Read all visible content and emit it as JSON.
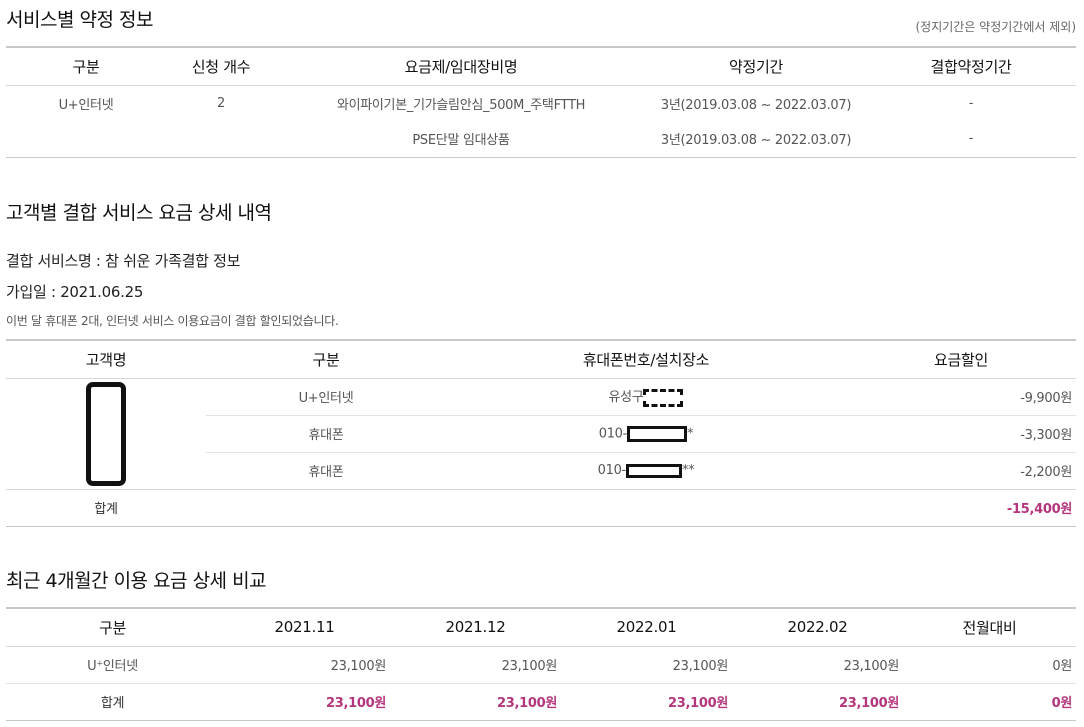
{
  "section1": {
    "title": "서비스별 약정 정보",
    "note": "(정지기간은 약정기간에서 제외)",
    "headers": [
      "구분",
      "신청 개수",
      "요금제/임대장비명",
      "약정기간",
      "결합약정기간"
    ],
    "rows": [
      {
        "category": "U+인터넷",
        "count": "2",
        "plan": "와이파이기본_기가슬림안심_500M_주택FTTH",
        "period": "3년(2019.03.08 ~ 2022.03.07)",
        "combined": "-"
      },
      {
        "category": "",
        "count": "",
        "plan": "PSE단말 임대상품",
        "period": "3년(2019.03.08 ~ 2022.03.07)",
        "combined": "-"
      }
    ]
  },
  "section2": {
    "title": "고객별 결합 서비스 요금 상세 내역",
    "service_name": "결합 서비스명 : 참 쉬운 가족결합 정보",
    "join_date": "가입일 : 2021.06.25",
    "description": "이번 달 휴대폰 2대, 인터넷 서비스 이용요금이 결합 할인되었습니다.",
    "headers": [
      "고객명",
      "구분",
      "휴대폰번호/설치장소",
      "요금할인"
    ],
    "rows": [
      {
        "category": "U+인터넷",
        "location_prefix": "유성구",
        "location_suffix": "",
        "discount": "-9,900원"
      },
      {
        "category": "휴대폰",
        "location_prefix": "010-",
        "location_suffix": "*",
        "discount": "-3,300원"
      },
      {
        "category": "휴대폰",
        "location_prefix": "010-",
        "location_suffix": "**",
        "discount": "-2,200원"
      }
    ],
    "total_label": "합계",
    "total_discount": "-15,400원"
  },
  "section3": {
    "title": "최근 4개월간 이용 요금 상세 비교",
    "headers": [
      "구분",
      "2021.11",
      "2021.12",
      "2022.01",
      "2022.02",
      "전월대비"
    ],
    "row": {
      "category": "U⁺인터넷",
      "values": [
        "23,100원",
        "23,100원",
        "23,100원",
        "23,100원",
        "0원"
      ]
    },
    "total": {
      "category": "합계",
      "values": [
        "23,100원",
        "23,100원",
        "23,100원",
        "23,100원",
        "0원"
      ]
    }
  },
  "colors": {
    "accent": "#b5357d",
    "rule": "#c8c8c8"
  }
}
